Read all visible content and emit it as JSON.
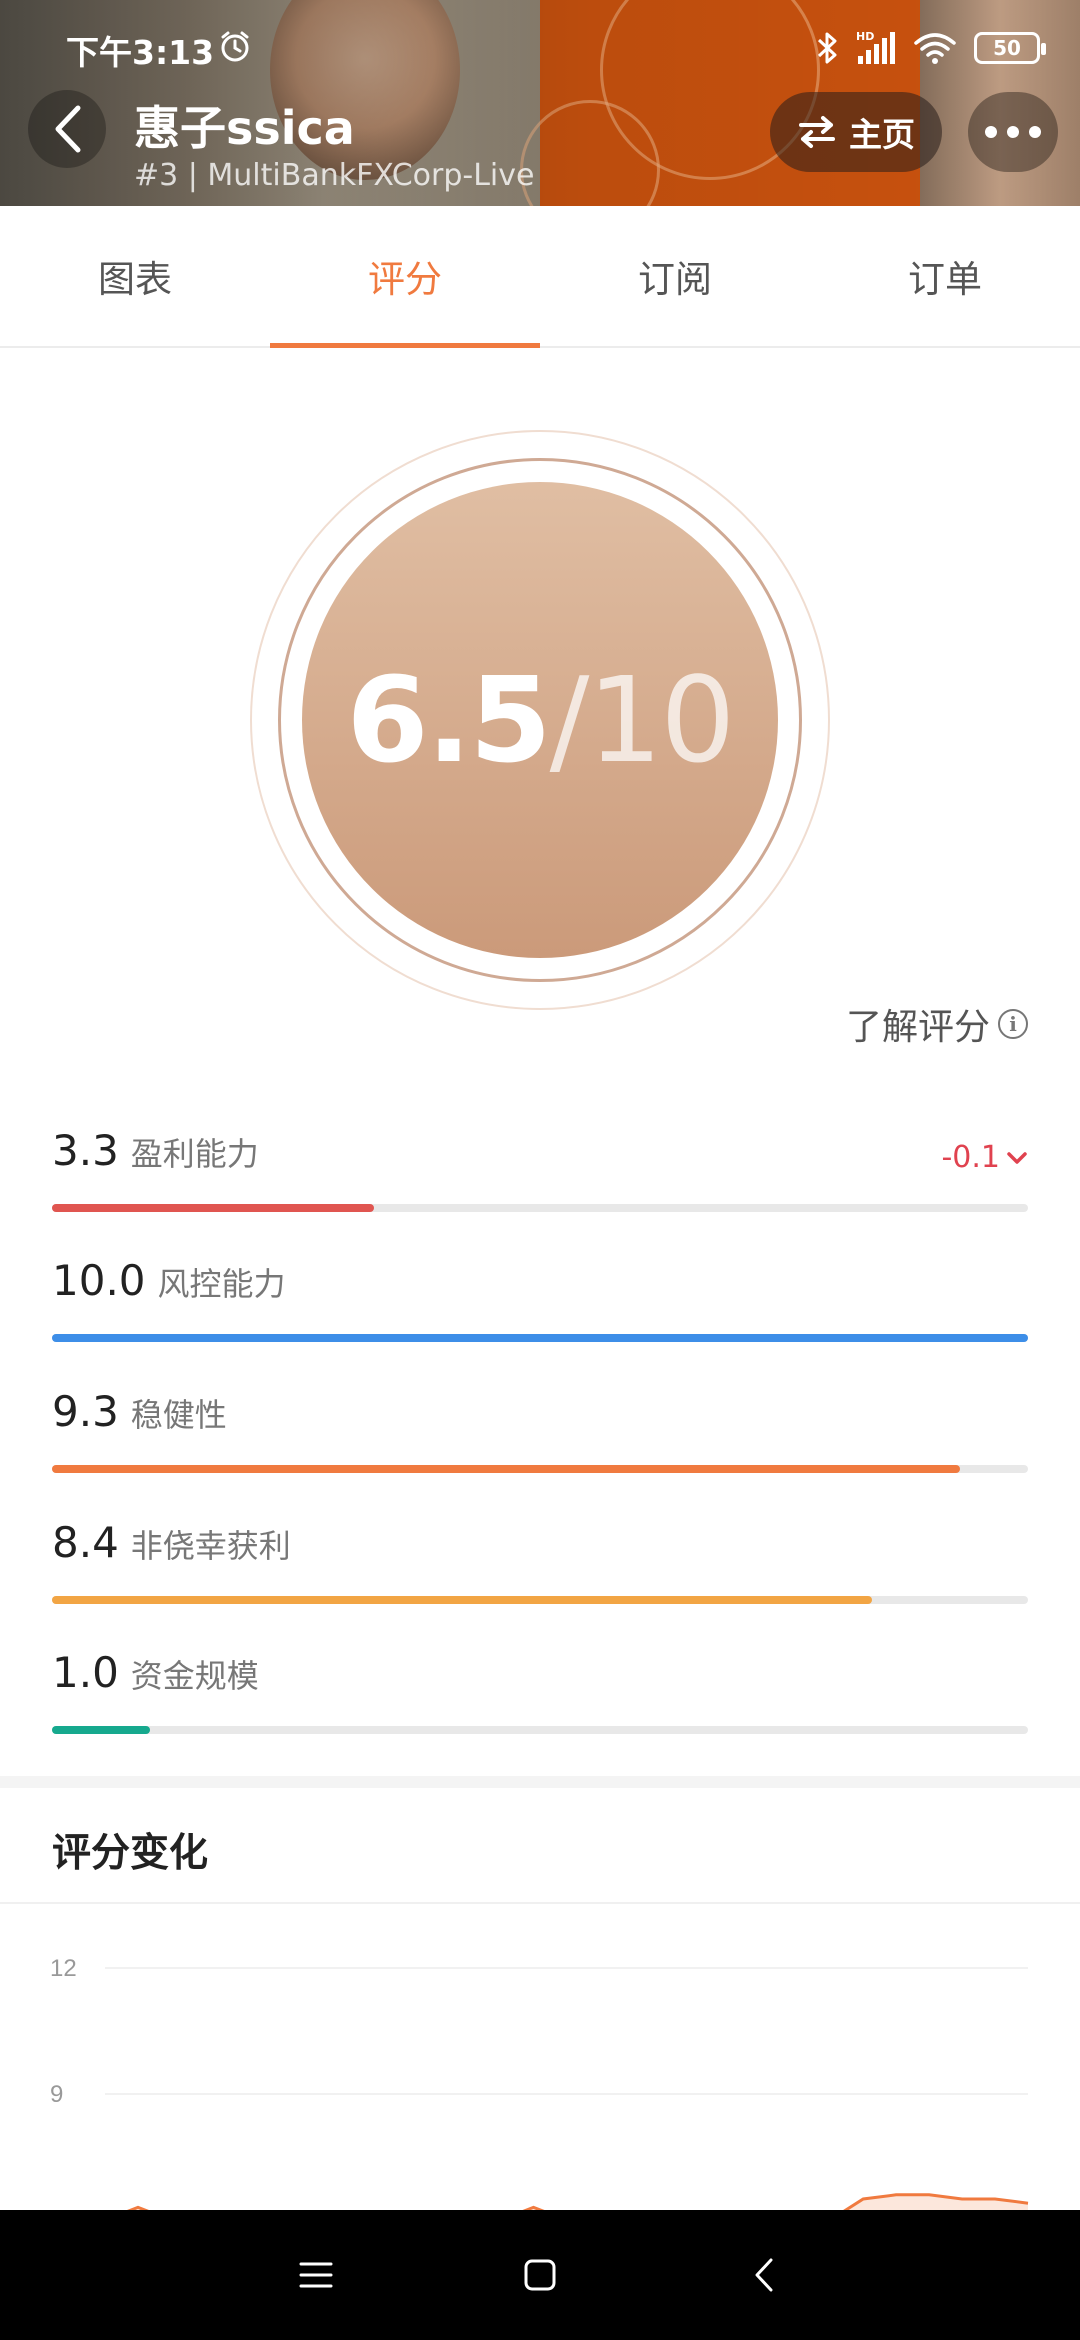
{
  "status_bar": {
    "time": "下午3:13",
    "battery": "50",
    "network_label": "HD"
  },
  "header": {
    "name": "惠子ssica",
    "subtitle": "#3 | MultiBankFXCorp-Live",
    "home_label": "主页"
  },
  "tabs": [
    {
      "label": "图表",
      "active": false
    },
    {
      "label": "评分",
      "active": true
    },
    {
      "label": "订阅",
      "active": false
    },
    {
      "label": "订单",
      "active": false
    }
  ],
  "score": {
    "value": "6.5",
    "denominator": "/10"
  },
  "learn_link": "了解评分",
  "metrics": [
    {
      "value": "3.3",
      "name": "盈利能力",
      "score": 3.3,
      "max": 10,
      "color": "#e05550",
      "change": "-0.1"
    },
    {
      "value": "10.0",
      "name": "风控能力",
      "score": 10.0,
      "max": 10,
      "color": "#3d8ee8"
    },
    {
      "value": "9.3",
      "name": "稳健性",
      "score": 9.3,
      "max": 10,
      "color": "#f07a3f"
    },
    {
      "value": "8.4",
      "name": "非侥幸获利",
      "score": 8.4,
      "max": 10,
      "color": "#f2a544"
    },
    {
      "value": "1.0",
      "name": "资金规模",
      "score": 1.0,
      "max": 10,
      "color": "#16a98e"
    }
  ],
  "section_title": "评分变化",
  "chart_data": {
    "type": "line",
    "title": "",
    "ylabel": "",
    "y_ticks": [
      "12",
      "9"
    ],
    "ylim": [
      6,
      12
    ],
    "color": "#f07a3f",
    "note": "partially visible; only tops of series visible near bottom edge",
    "series": [
      {
        "values": [
          6.0,
          6.3,
          6.0,
          6.0,
          6.0,
          6.0,
          6.0,
          6.0,
          6.0,
          6.0,
          6.0,
          6.0,
          6.0,
          6.3,
          6.0,
          6.2,
          6.0,
          6.0,
          6.0,
          6.0,
          6.0,
          6.0,
          6.0,
          6.5,
          6.6,
          6.6,
          6.5,
          6.5,
          6.4
        ]
      }
    ]
  }
}
